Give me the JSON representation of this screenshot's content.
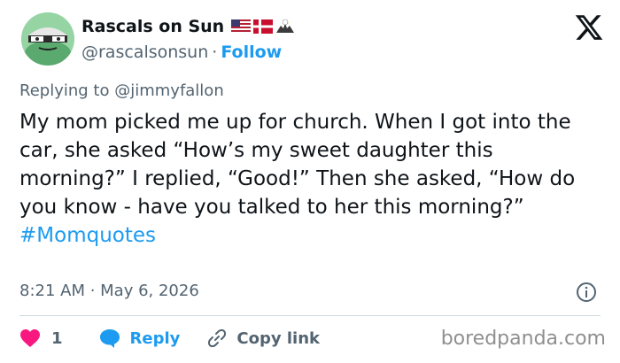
{
  "author": {
    "display_name": "Rascals on Sun",
    "handle": "@rascalsonsun",
    "separator": "·",
    "follow_label": "Follow",
    "flag_icons": [
      "us-flag-icon",
      "denmark-flag-icon",
      "eagle-icon"
    ]
  },
  "reply_context": {
    "prefix": "Replying to",
    "mention": "@jimmyfallon"
  },
  "tweet": {
    "text": "My mom picked me up for church. When I got into the car, she asked “How’s my sweet daughter this morning?” I replied, “Good!” Then she asked, “How do you know - have you talked to her this morning?”",
    "hashtag": "#Momquotes",
    "timestamp": "8:21 AM · May 6, 2026"
  },
  "actions": {
    "like_count": "1",
    "reply_label": "Reply",
    "copy_label": "Copy link"
  },
  "watermark": "boredpanda.com",
  "colors": {
    "accent": "#1d9bf0",
    "like": "#f91880",
    "muted": "#536471",
    "text": "#0f1419"
  }
}
